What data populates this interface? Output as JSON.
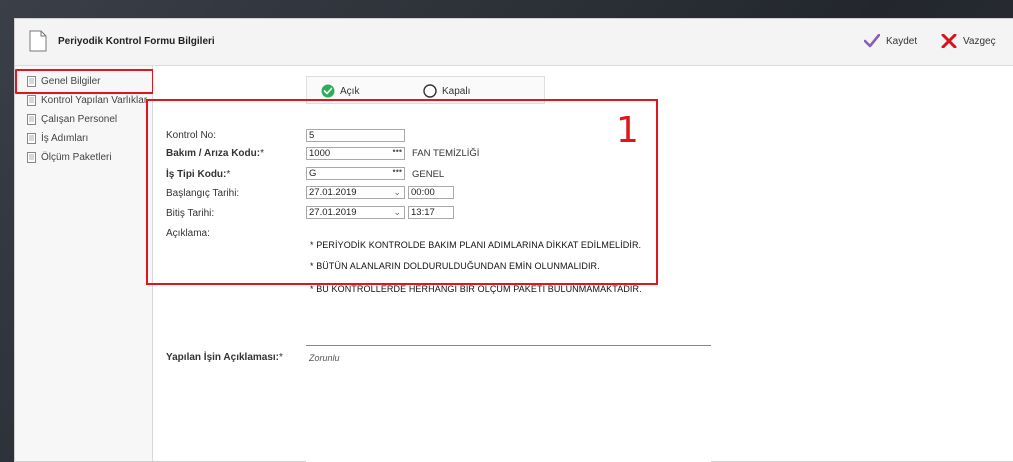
{
  "modal": {
    "title": "Periyodik Kontrol Formu Bilgileri",
    "save_label": "Kaydet",
    "cancel_label": "Vazgeç"
  },
  "sidebar": {
    "items": [
      {
        "label": "Genel Bilgiler",
        "icon": "document-list-icon"
      },
      {
        "label": "Kontrol Yapılan Varlıklar",
        "icon": "document-list-icon"
      },
      {
        "label": "Çalışan Personel",
        "icon": "document-list-icon"
      },
      {
        "label": "İş Adımları",
        "icon": "document-list-icon"
      },
      {
        "label": "Ölçüm Paketleri",
        "icon": "document-list-icon"
      }
    ]
  },
  "status": {
    "open_label": "Açık",
    "closed_label": "Kapalı",
    "selected": "Açık"
  },
  "form": {
    "kontrol_no_label": "Kontrol No:",
    "kontrol_no_value": "5",
    "bakim_label": "Bakım / Arıza Kodu:",
    "bakim_value": "1000",
    "bakim_desc": "FAN TEMİZLİĞİ",
    "is_tipi_label": "İş Tipi Kodu:",
    "is_tipi_value": "G",
    "is_tipi_desc": "GENEL",
    "baslangic_label": "Başlangıç Tarihi:",
    "baslangic_date": "27.01.2019",
    "baslangic_time": "00:00",
    "bitis_label": "Bitiş Tarihi:",
    "bitis_date": "27.01.2019",
    "bitis_time": "13:17",
    "aciklama_label": "Açıklama:",
    "aciklama_lines": [
      "* PERİYODİK KONTROLDE BAKIM PLANI ADIMLARINA DİKKAT EDİLMELİDİR.",
      "* BÜTÜN ALANLARIN DOLDURULDUĞUNDAN EMİN OLUNMALIDIR.",
      "* BU KONTROLLERDE HERHANGİ BİR ÖLÇÜM PAKETİ BULUNMAMAKTADIR."
    ],
    "yapilan_label": "Yapılan İşin Açıklaması:",
    "yapilan_placeholder": "Zorunlu",
    "required_mark": "*"
  },
  "annotation": {
    "number": "1",
    "color": "#e0161e"
  },
  "colors": {
    "accent_green": "#2eae5a",
    "save_check": "#8a5fb8",
    "cancel_x": "#d7141b"
  }
}
